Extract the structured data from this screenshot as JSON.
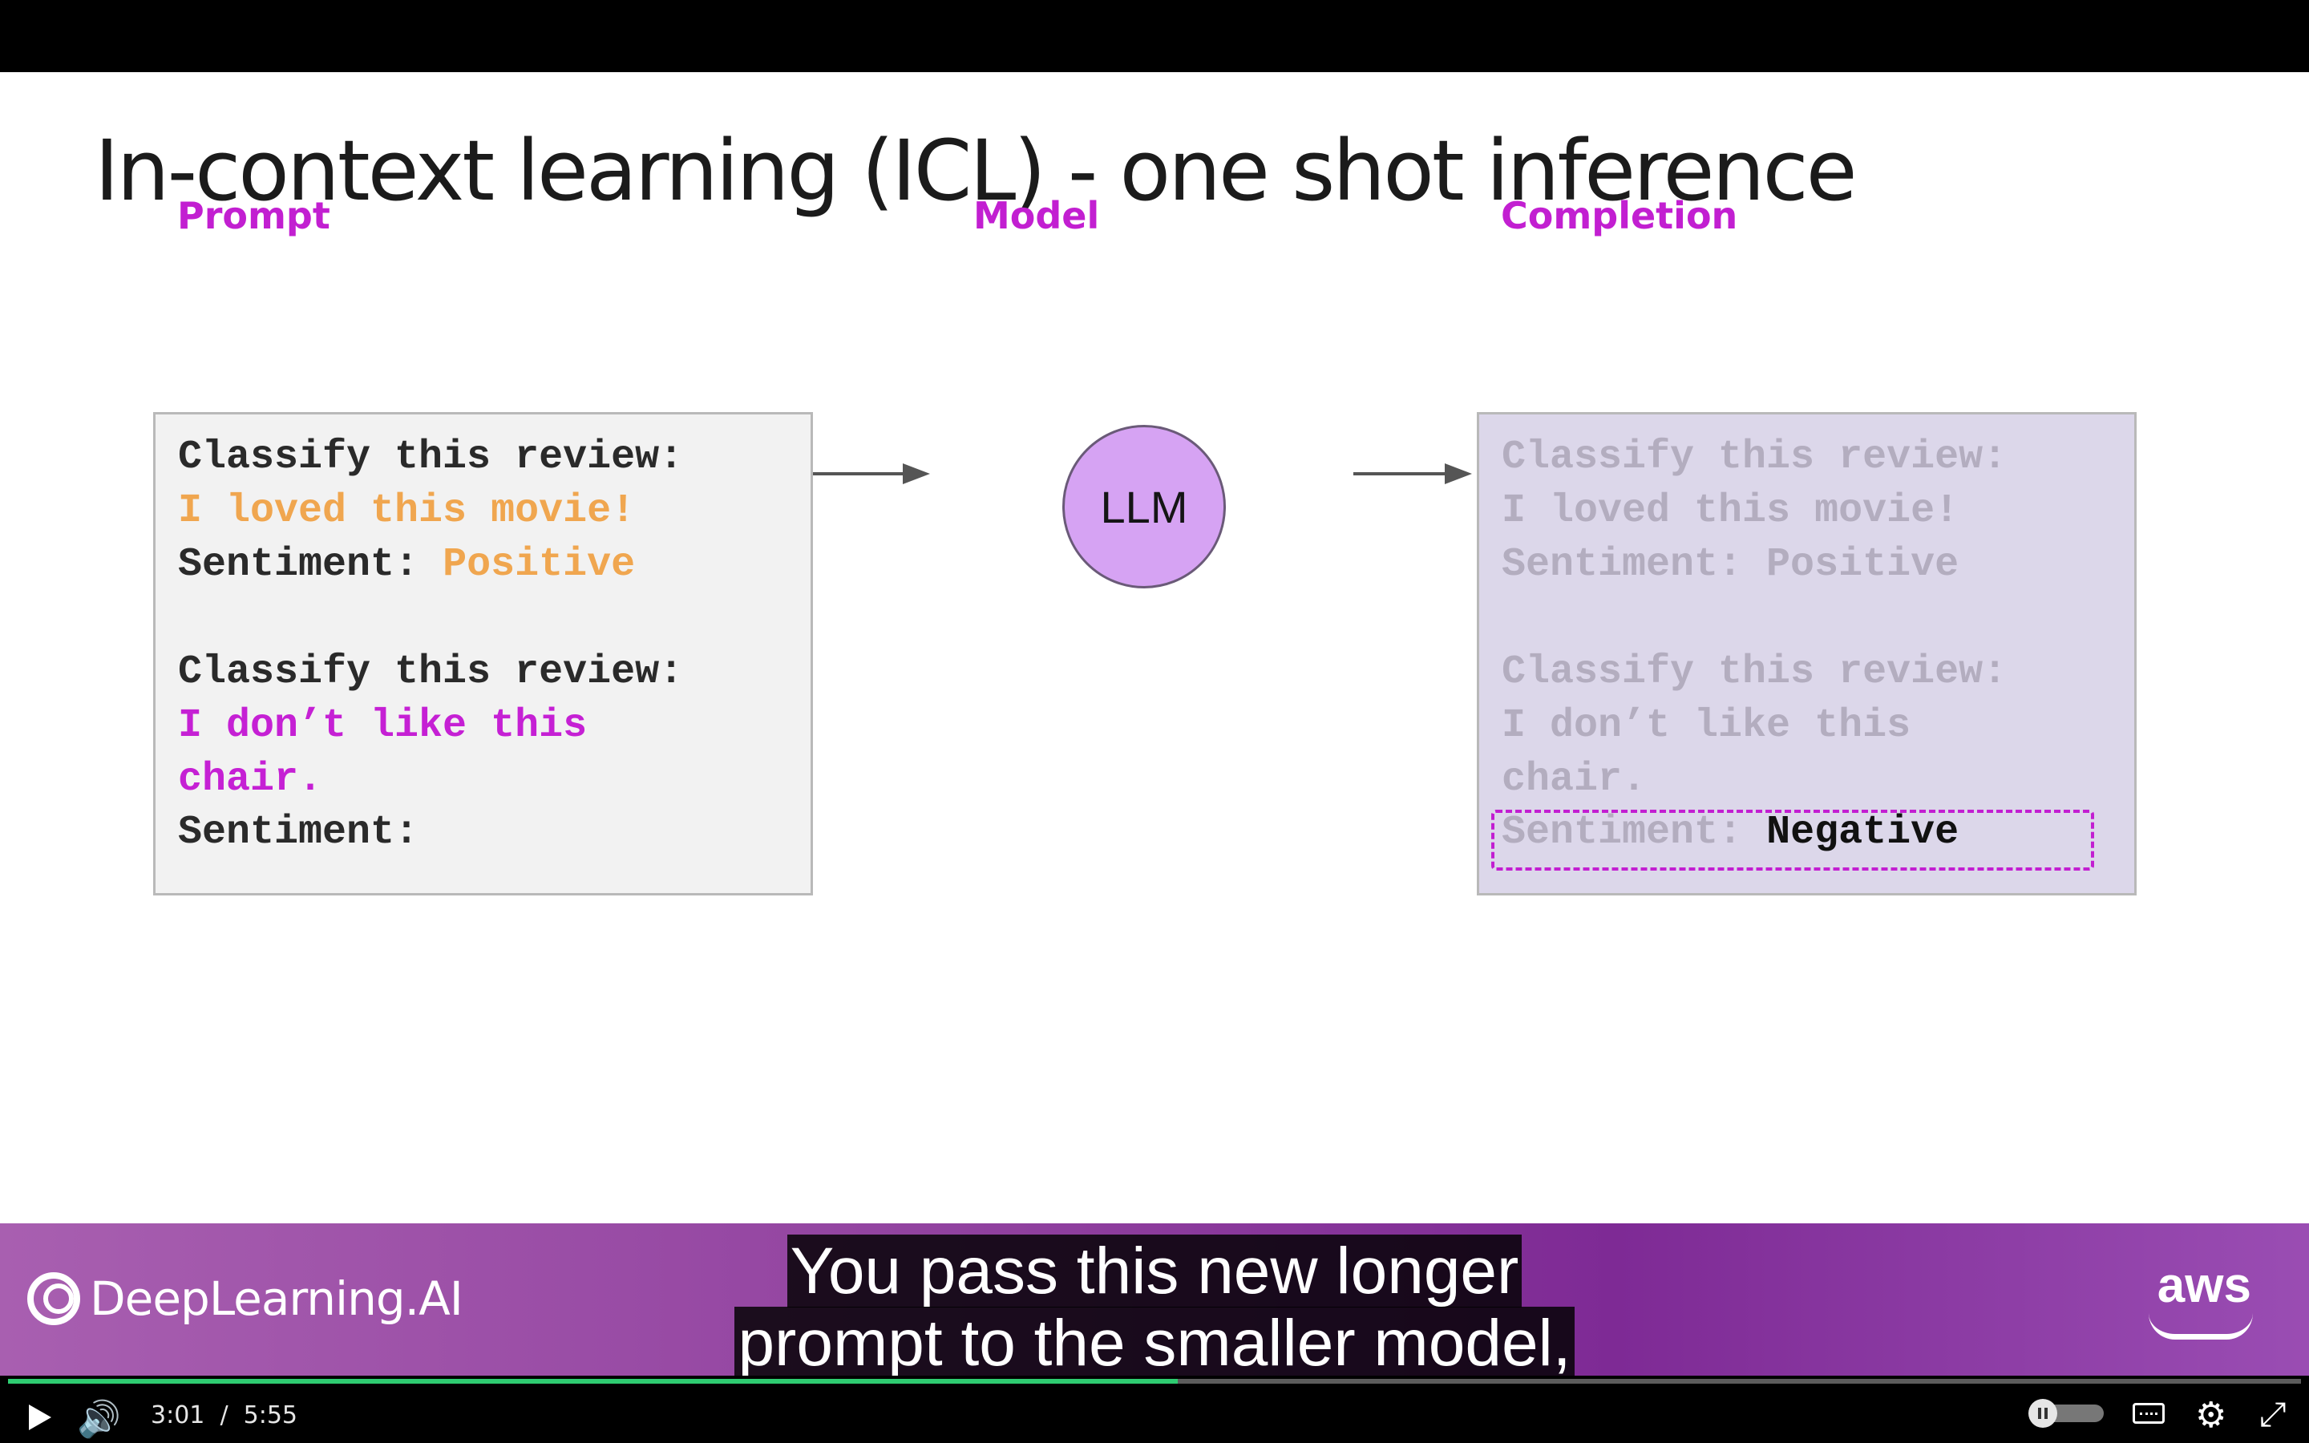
{
  "slide": {
    "title": "In-context learning (ICL) - one shot inference",
    "labels": {
      "prompt": "Prompt",
      "model": "Model",
      "completion": "Completion"
    },
    "model_name": "LLM",
    "prompt_lines": [
      "Classify this review:",
      "I loved this movie!",
      "Sentiment: ",
      "Positive",
      "Classify this review:",
      "I don’t like this",
      "chair.",
      "Sentiment:"
    ],
    "completion_lines": [
      "Classify this review:",
      "I loved this movie!",
      "Sentiment: Positive",
      "Classify this review:",
      "I don’t like this",
      "chair.",
      "Sentiment: ",
      "Negative"
    ]
  },
  "brand": {
    "left_logo": "DeepLearning.AI",
    "right_logo": "aws"
  },
  "captions": {
    "line1": "You pass this new longer",
    "line2": "prompt to the smaller model,"
  },
  "player": {
    "current_time": "3:01",
    "separator": "/",
    "duration": "5:55",
    "progress_fraction": 0.51
  },
  "colors": {
    "accent_purple": "#c21fd1",
    "example_orange": "#f0a64f",
    "progress_green": "#2ecc71"
  },
  "icons": [
    "play-icon",
    "volume-icon",
    "pause-toggle-icon",
    "closed-captions-icon",
    "gear-icon",
    "exit-fullscreen-icon"
  ]
}
